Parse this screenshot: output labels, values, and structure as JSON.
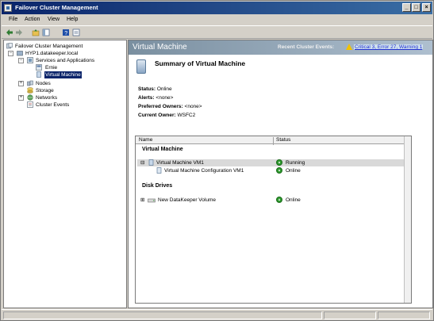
{
  "window": {
    "title": "Failover Cluster Management",
    "controls": {
      "minimize": "_",
      "restore": "□",
      "close": "×"
    }
  },
  "menu": [
    "File",
    "Action",
    "View",
    "Help"
  ],
  "toolbar": {
    "icons": [
      "back-arrow-icon",
      "forward-arrow-icon",
      "folder-up-icon",
      "show-hide-tree-icon",
      "help-icon",
      "properties-icon"
    ]
  },
  "tree": {
    "root": "Failover Cluster Management",
    "cluster": "HYP1.datakeeper.local",
    "services": "Services and Applications",
    "service_items": [
      "Ernie",
      "Virtual Machine"
    ],
    "nodes": "Nodes",
    "storage": "Storage",
    "networks": "Networks",
    "events": "Cluster Events"
  },
  "header": {
    "title": "Virtual Machine",
    "events_label": "Recent Cluster Events:",
    "events_link": "Critical 3, Error 27, Warning 1"
  },
  "summary": {
    "title": "Summary of Virtual Machine",
    "props": [
      {
        "label": "Status:",
        "value": "Online"
      },
      {
        "label": "Alerts:",
        "value": "<none>"
      },
      {
        "label": "Preferred Owners:",
        "value": "<none>"
      },
      {
        "label": "Current Owner:",
        "value": "WSFC2"
      }
    ]
  },
  "grid": {
    "columns": [
      "Name",
      "Status"
    ],
    "groups": [
      {
        "title": "Virtual Machine",
        "rows": [
          {
            "name": "Virtual Machine VM1",
            "status": "Running",
            "expander": "⊟"
          },
          {
            "name": "Virtual Machine Configuration VM1",
            "status": "Online"
          }
        ]
      },
      {
        "title": "Disk Drives",
        "rows": [
          {
            "name": "New DataKeeper Volume",
            "status": "Online",
            "expander": "⊞"
          }
        ]
      }
    ]
  },
  "colors": {
    "titlebar": "#0a246a",
    "header": "#7a8fa0",
    "selection": "#0a246a",
    "status_ok": "#2d9a2d",
    "warning": "#f2c200"
  }
}
